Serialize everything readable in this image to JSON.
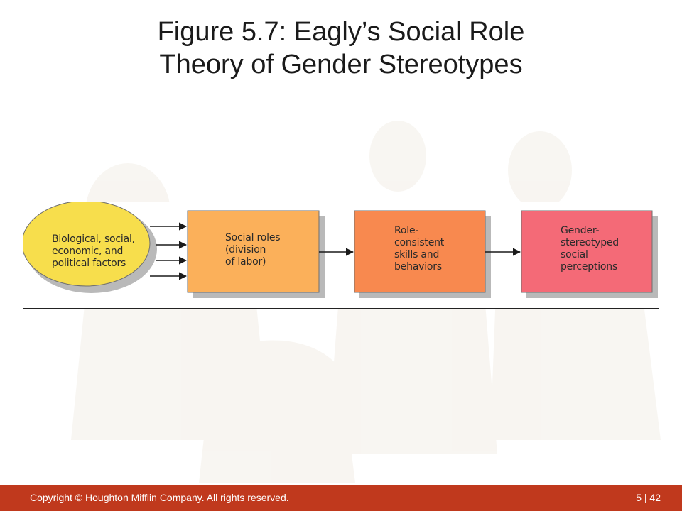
{
  "slide": {
    "title_line1": "Figure 5.7: Eagly’s Social Role",
    "title_line2": "Theory of Gender Stereotypes"
  },
  "diagram": {
    "nodes": [
      {
        "id": "factors",
        "shape": "ellipse",
        "color": "#f7de4c",
        "lines": [
          "Biological, social,",
          "economic, and",
          "political factors"
        ]
      },
      {
        "id": "social-roles",
        "shape": "box",
        "color": "#fbb05a",
        "lines": [
          "Social roles",
          "(division",
          "of labor)"
        ]
      },
      {
        "id": "role-skills",
        "shape": "box",
        "color": "#f8894f",
        "lines": [
          "Role-",
          "consistent",
          "skills and",
          "behaviors"
        ]
      },
      {
        "id": "perceptions",
        "shape": "box",
        "color": "#f46a77",
        "lines": [
          "Gender-",
          "stereotyped",
          "social",
          "perceptions"
        ]
      }
    ]
  },
  "footer": {
    "copyright": "Copyright © Houghton Mifflin Company. All rights reserved.",
    "page": "5 | 42"
  },
  "colors": {
    "footer_bg": "#c0391d",
    "ellipse_fill": "#f7de4c",
    "box1_fill": "#fbb05a",
    "box2_fill": "#f8894f",
    "box3_fill": "#f46a77"
  }
}
